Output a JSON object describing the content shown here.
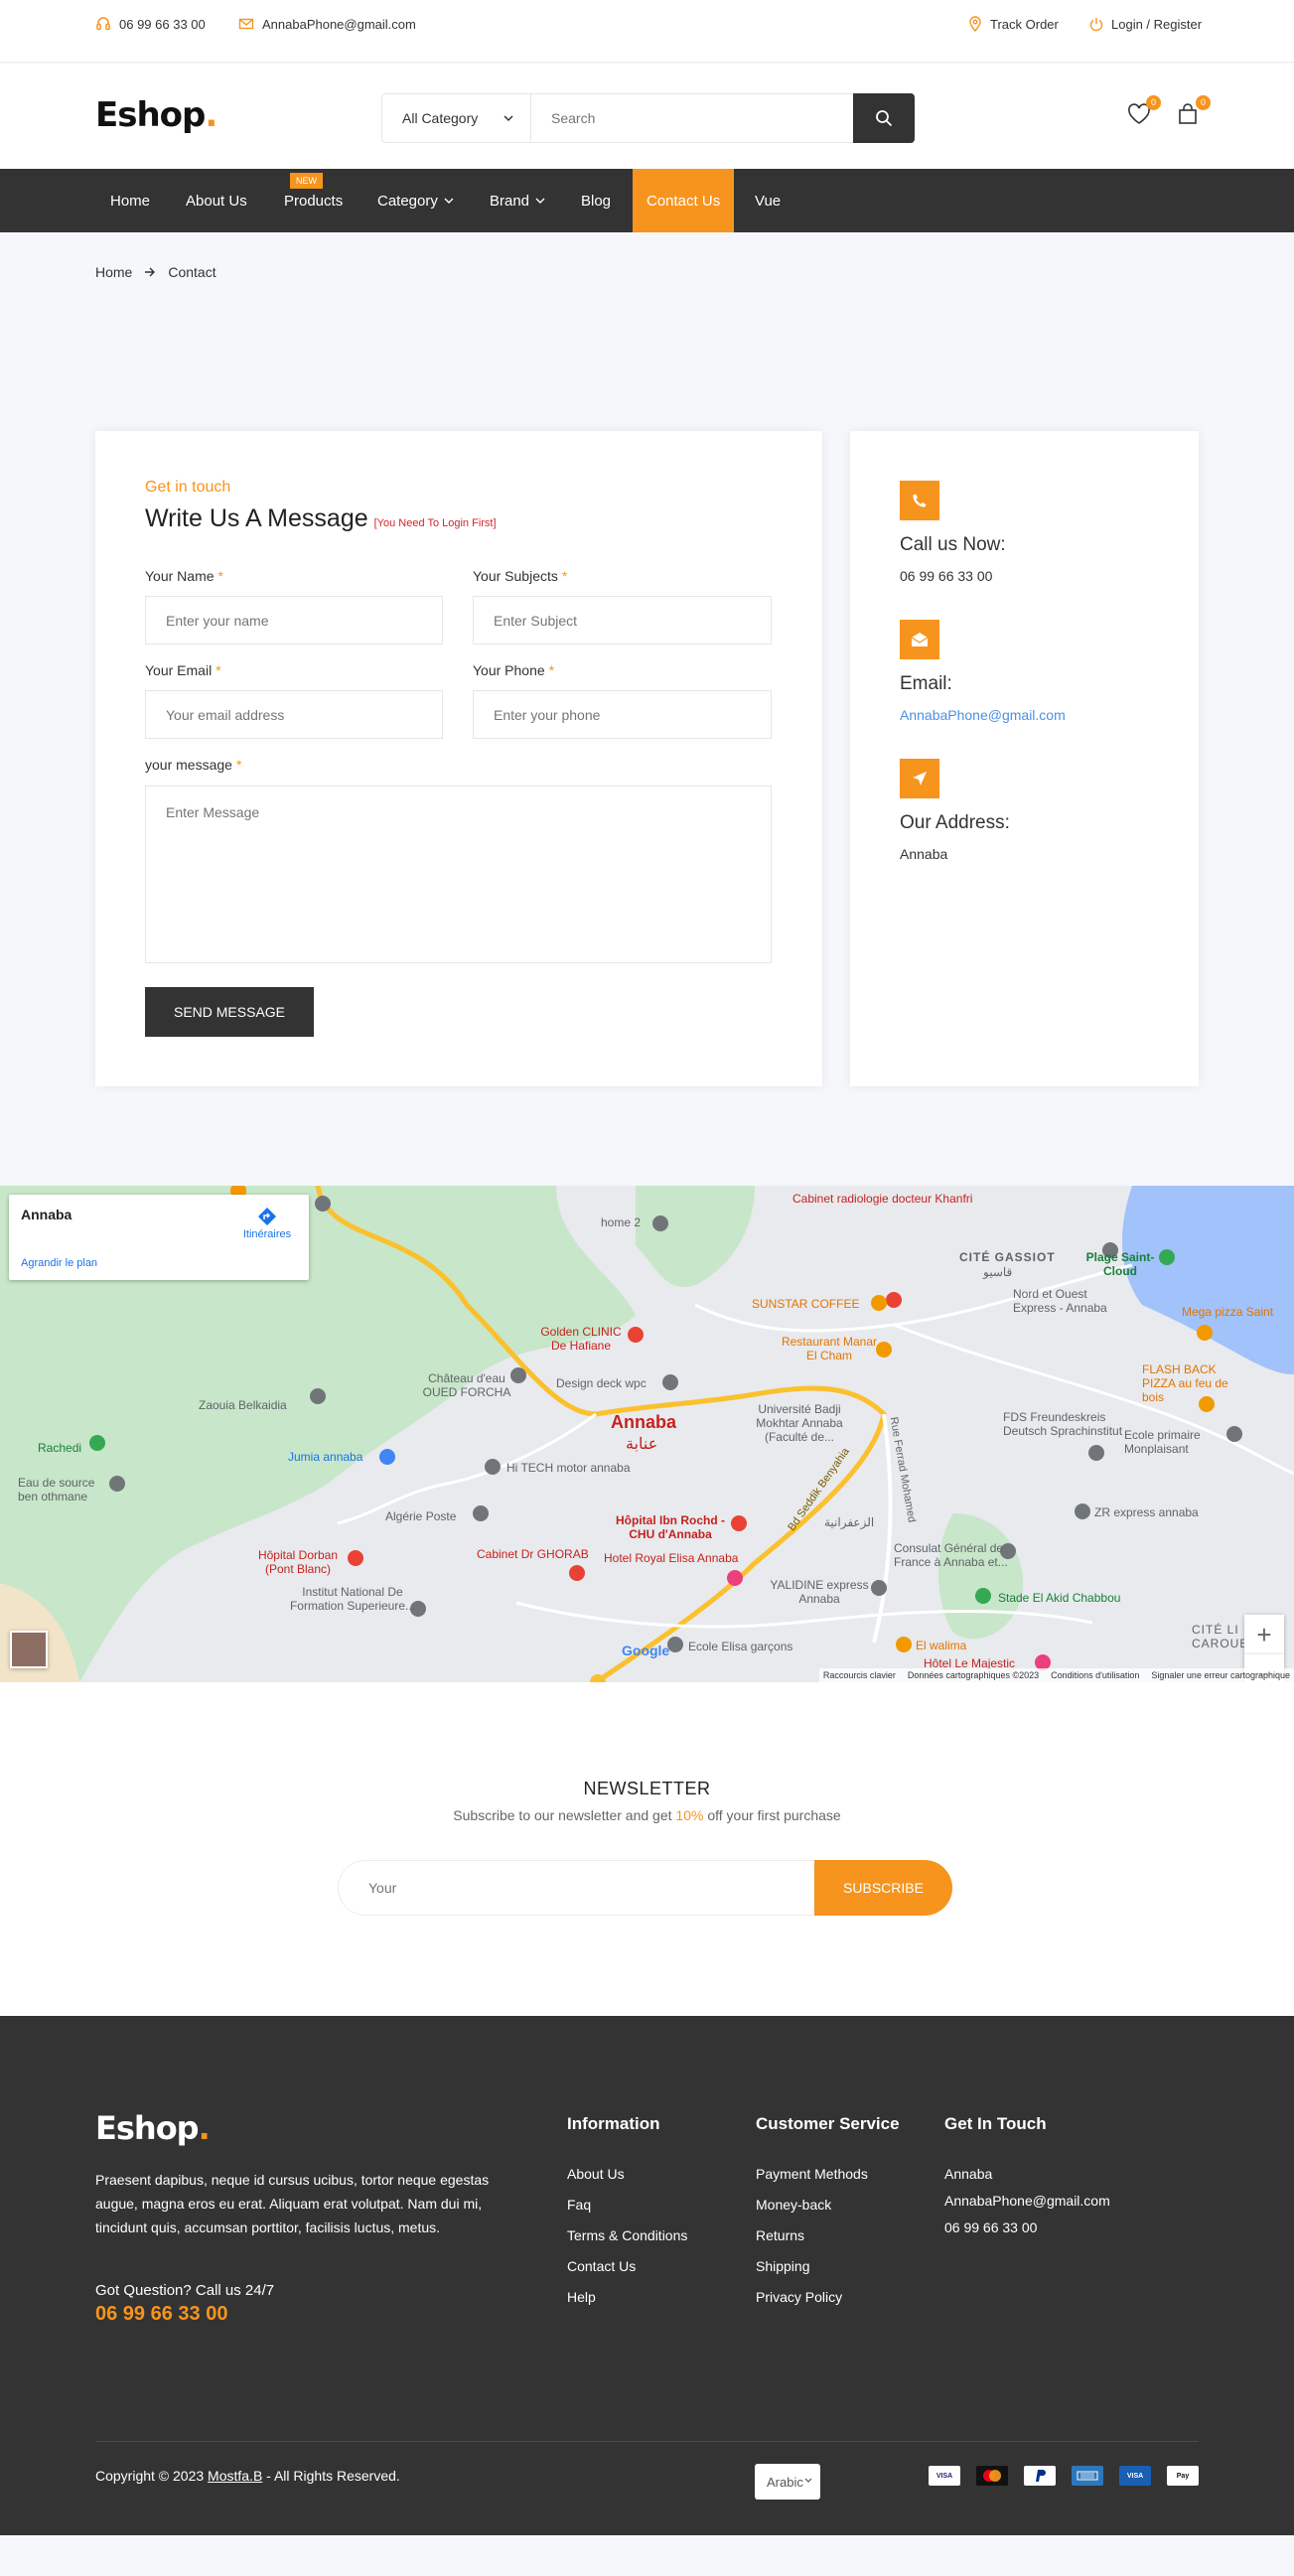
{
  "topbar": {
    "phone": "06 99 66 33 00",
    "email": "AnnabaPhone@gmail.com",
    "track_order": "Track Order",
    "login_register": "Login / Register"
  },
  "header": {
    "logo_text": "Eshop",
    "logo_dot": ".",
    "category_select": "All Category",
    "search_placeholder": "Search",
    "wishlist_count": "0",
    "cart_count": "0"
  },
  "nav": {
    "items": [
      {
        "label": "Home"
      },
      {
        "label": "About Us"
      },
      {
        "label": "Products",
        "tag": "NEW"
      },
      {
        "label": "Category"
      },
      {
        "label": "Brand"
      },
      {
        "label": "Blog"
      },
      {
        "label": "Contact Us"
      },
      {
        "label": "Vue"
      }
    ]
  },
  "breadcrumb": {
    "home": "Home",
    "current": "Contact"
  },
  "contact_form": {
    "eyebrow": "Get in touch",
    "title": "Write Us A Message",
    "note": "[You Need To Login First]",
    "name_label": "Your Name",
    "name_placeholder": "Enter your name",
    "subject_label": "Your Subjects",
    "subject_placeholder": "Enter Subject",
    "email_label": "Your Email",
    "email_placeholder": "Your email address",
    "phone_label": "Your Phone",
    "phone_placeholder": "Enter your phone",
    "message_label": "your message",
    "message_placeholder": "Enter Message",
    "required_mark": "*",
    "send_label": "SEND MESSAGE"
  },
  "contact_info": {
    "call_title": "Call us Now:",
    "call_value": "06 99 66 33 00",
    "email_title": "Email:",
    "email_value": "AnnabaPhone@gmail.com",
    "address_title": "Our Address:",
    "address_value": "Annaba"
  },
  "map": {
    "card_title": "Annaba",
    "card_link": "Agrandir le plan",
    "directions": "Itinéraires",
    "zoom_in": "+",
    "zoom_out": "−",
    "labels": [
      "Cabinet radiologie docteur Khanfri",
      "CITÉ GASSIOT",
      "قاسيو",
      "home 2",
      "SUNSTAR COFFEE",
      "Nord et Ouest Express - Annaba",
      "Plage Saint-Cloud",
      "Golden CLINIC De Hafiane",
      "Restaurant Manar El Cham",
      "Mega pizza Saint",
      "Château d'eau OUED FORCHA",
      "Design deck wpc",
      "FLASH BACK PIZZA au feu de bois",
      "Zaouia Belkaidia",
      "Université Badji Mokhtar Annaba (Faculté de...",
      "Annaba",
      "عنابة",
      "FDS Freundeskreis Deutsch Sprachinstitut",
      "Rachedi",
      "Jumia annaba",
      "Hi TECH motor annaba",
      "Ecole primaire Monplaisant",
      "Eau de source ben othmane",
      "Algérie Poste",
      "Hôpital Ibn Rochd - CHU d'Annaba",
      "ZR express annaba",
      "Hôpital Dorban (Pont Blanc)",
      "Cabinet Dr GHORAB",
      "Hotel Royal Elisa Annaba",
      "Consulat Général de France à Annaba et...",
      "Institut National De Formation Superieure...",
      "YALIDINE express Annaba",
      "Stade El Akid Chabbou",
      "El walima",
      "Ecole Elisa garçons",
      "Hôtel Le Majestic",
      "CITÉ LI CAROUBI",
      "Bd Seddik Benyahia",
      "Rue Ferrad Mohamed",
      "الزعفرانية"
    ],
    "attribution": "Données cartographiques ©2023",
    "shortcuts": "Raccourcis clavier",
    "terms": "Conditions d'utilisation",
    "report": "Signaler une erreur cartographique",
    "google": "Google"
  },
  "newsletter": {
    "title": "NEWSLETTER",
    "subtitle_pre": "Subscribe to our newsletter and get ",
    "subtitle_highlight": "10%",
    "subtitle_post": " off your first purchase",
    "input_placeholder": "Your",
    "button": "SUBSCRIBE"
  },
  "footer": {
    "logo_text": "Eshop",
    "logo_dot": ".",
    "about": "Praesent dapibus, neque id cursus ucibus, tortor neque egestas augue, magna eros eu erat. Aliquam erat volutpat. Nam dui mi, tincidunt quis, accumsan porttitor, facilisis luctus, metus.",
    "question": "Got Question? Call us 24/7",
    "phone": "06 99 66 33 00",
    "information_title": "Information",
    "information_links": [
      "About Us",
      "Faq",
      "Terms & Conditions",
      "Contact Us",
      "Help"
    ],
    "service_title": "Customer Service",
    "service_links": [
      "Payment Methods",
      "Money-back",
      "Returns",
      "Shipping",
      "Privacy Policy"
    ],
    "touch_title": "Get In Touch",
    "touch_items": [
      "Annaba",
      "AnnabaPhone@gmail.com",
      "06 99 66 33 00"
    ],
    "copyright_pre": "Copyright © 2023 ",
    "copyright_author": "Mostfa.B",
    "copyright_post": " - All Rights Reserved.",
    "language": "Arabic",
    "payments": [
      "VISA",
      "mastercard",
      "PayPal",
      "amex",
      "VISA",
      "Pay"
    ]
  },
  "colors": {
    "accent": "#f7941d",
    "dark": "#333333",
    "link": "#4a90e2"
  }
}
